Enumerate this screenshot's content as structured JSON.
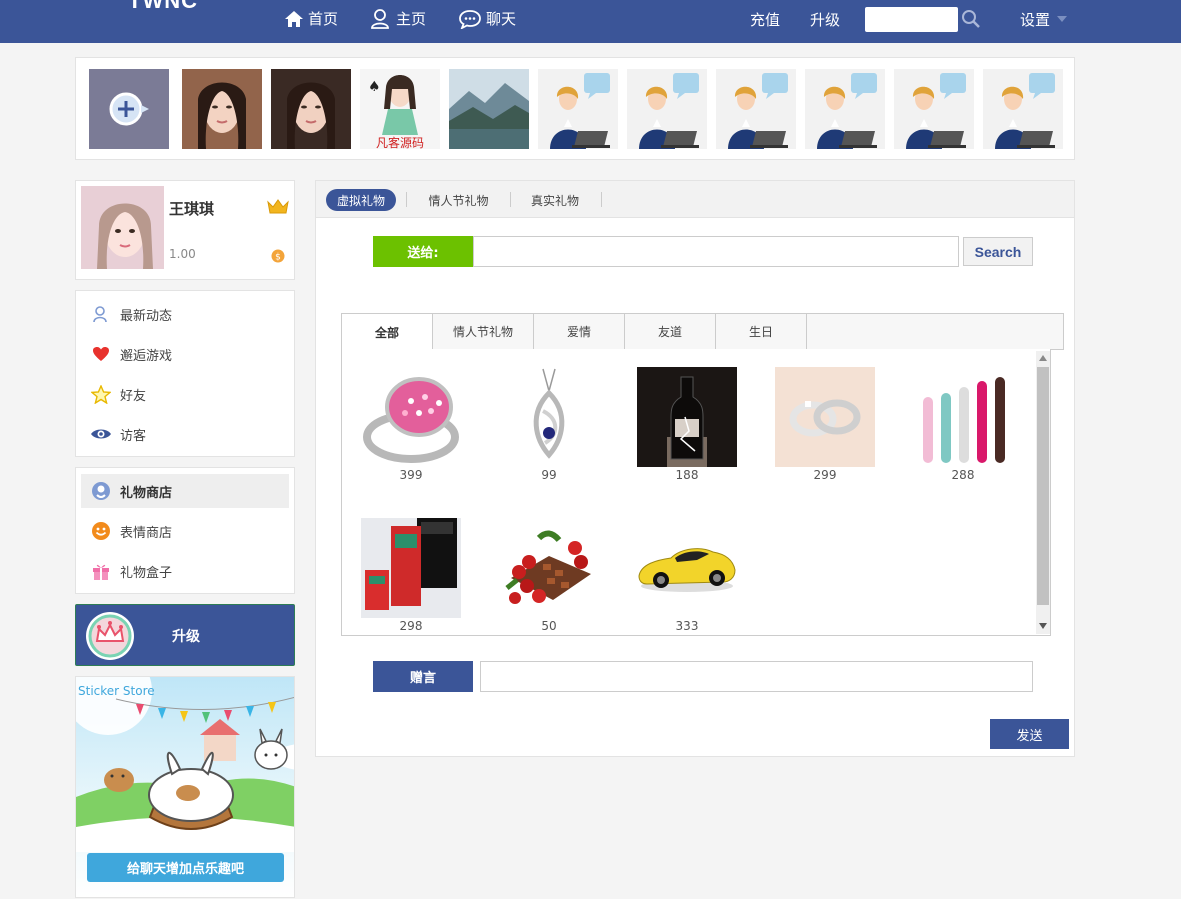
{
  "header": {
    "logo": "TWNC",
    "nav": [
      {
        "label": "首页",
        "icon": "home-icon"
      },
      {
        "label": "主页",
        "icon": "user-icon"
      },
      {
        "label": "聊天",
        "icon": "chat-icon"
      }
    ],
    "recharge_label": "充值",
    "upgrade_label": "升级",
    "search_placeholder": "",
    "settings_label": "设置"
  },
  "photo_strip": {
    "items": [
      "add-photo",
      "user-photo",
      "user-photo",
      "user-photo",
      "landscape-photo",
      "default-avatar",
      "default-avatar",
      "default-avatar",
      "default-avatar",
      "default-avatar",
      "default-avatar"
    ],
    "watermark_text": "凡客源码"
  },
  "profile": {
    "name": "王琪琪",
    "balance": "1.00",
    "crown_icon": "crown-icon",
    "coin_icon": "coin-icon"
  },
  "menu_primary": [
    {
      "label": "最新动态",
      "icon": "user-outline-icon"
    },
    {
      "label": "邂逅游戏",
      "icon": "heart-icon"
    },
    {
      "label": "好友",
      "icon": "star-icon"
    },
    {
      "label": "访客",
      "icon": "eye-icon"
    }
  ],
  "menu_shop": [
    {
      "label": "礼物商店",
      "icon": "gift-shop-icon",
      "active": true
    },
    {
      "label": "表情商店",
      "icon": "smiley-icon"
    },
    {
      "label": "礼物盒子",
      "icon": "gift-box-icon"
    }
  ],
  "upgrade_banner": {
    "label": "升级"
  },
  "sticker_promo": {
    "title": "Sticker Store",
    "button_label": "给聊天增加点乐趣吧"
  },
  "gift_panel": {
    "tabs": [
      "虚拟礼物",
      "情人节礼物",
      "真实礼物"
    ],
    "active_tab": 0,
    "send_to_label": "送给:",
    "send_to_value": "",
    "search_label": "Search",
    "category_tabs": [
      "全部",
      "情人节礼物",
      "爱情",
      "友道",
      "生日"
    ],
    "active_category": 0,
    "gifts": [
      {
        "price": "399",
        "kind": "ring"
      },
      {
        "price": "99",
        "kind": "pendant"
      },
      {
        "price": "188",
        "kind": "wine"
      },
      {
        "price": "299",
        "kind": "couple-rings"
      },
      {
        "price": "288",
        "kind": "toys"
      },
      {
        "price": "298",
        "kind": "box"
      },
      {
        "price": "50",
        "kind": "roses"
      },
      {
        "price": "333",
        "kind": "sports-car"
      }
    ],
    "message_label": "赠言",
    "message_value": "",
    "send_label": "发送"
  },
  "colors": {
    "brand_blue": "#3b5598",
    "green": "#6cc100",
    "sticker_button": "#3fa7dc"
  }
}
